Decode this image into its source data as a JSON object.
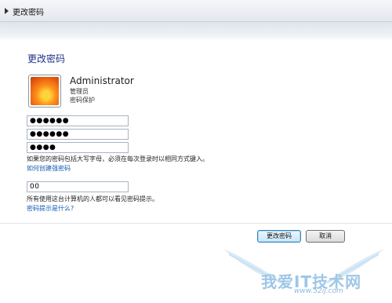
{
  "breadcrumb": {
    "label": "更改密码"
  },
  "page": {
    "title": "更改密码"
  },
  "user": {
    "name": "Administrator",
    "role": "管理员",
    "status": "密码保护"
  },
  "fields": {
    "current_password": "●●●●●●",
    "new_password": "●●●●●●",
    "confirm_password": "●●●●",
    "hint": "00"
  },
  "notes": {
    "case_sensitive": "如果您的密码包括大写字母，必须在每次登录时以相同方式键入。",
    "strong_password_link": "如何创建强密码",
    "hint_visible": "所有使用这台计算机的人都可以看见密码提示。",
    "hint_link": "密码提示是什么?"
  },
  "buttons": {
    "change": "更改密码",
    "cancel": "取消"
  },
  "watermark": {
    "text": "我爱IT技术网",
    "url": "www.52ij.com"
  },
  "colors": {
    "title": "#1e3287",
    "link": "#0f5ab5",
    "primary_border": "#3c7fb1"
  },
  "icons": {
    "breadcrumb_arrow": "chevron-right-icon",
    "avatar": "flower-user-picture"
  }
}
